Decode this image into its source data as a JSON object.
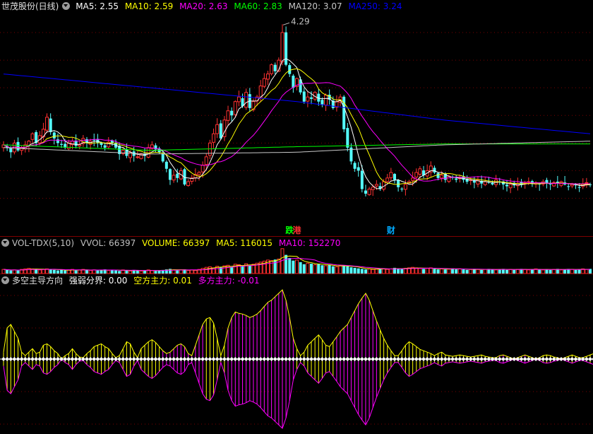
{
  "price_legend": {
    "stock_title": "世茂股份(日线)",
    "items": [
      {
        "label": "MA5: 2.55",
        "color": "#ffffff"
      },
      {
        "label": "MA10: 2.59",
        "color": "#ffff00"
      },
      {
        "label": "MA20: 2.63",
        "color": "#ff00ff"
      },
      {
        "label": "MA60: 2.83",
        "color": "#00ff00"
      },
      {
        "label": "MA120: 3.07",
        "color": "#c8c8c8"
      },
      {
        "label": "MA250: 3.24",
        "color": "#0000ff"
      }
    ]
  },
  "vol_legend": {
    "title": "VOL-TDX(5,10)",
    "items": [
      {
        "label": "VVOL: 66397",
        "color": "#c0c0c0"
      },
      {
        "label": "VOLUME: 66397",
        "color": "#ffff00"
      },
      {
        "label": "MA5: 116015",
        "color": "#ffff00"
      },
      {
        "label": "MA10: 152270",
        "color": "#ff00ff"
      }
    ]
  },
  "osc_legend": {
    "title": "多空主导方向",
    "items": [
      {
        "label": "强弱分界: 0.00",
        "color": "#ffffff"
      },
      {
        "label": "空方主力: 0.01",
        "color": "#ffff00"
      },
      {
        "label": "多方主力: -0.01",
        "color": "#ff00ff"
      }
    ]
  },
  "badges": [
    {
      "text": "跌",
      "color": "#00ff00",
      "candle": 79
    },
    {
      "text": "港",
      "color": "#ff3030",
      "candle": 81
    },
    {
      "text": "财",
      "color": "#00aaff",
      "candle": 107
    }
  ],
  "chart_data": [
    {
      "type": "candlestick",
      "title": "世茂股份(日线)",
      "annotations": [
        {
          "text": "4.29",
          "candle": 77,
          "value": 4.29,
          "note": "high"
        }
      ],
      "close": [
        2.98,
        2.95,
        2.9,
        3.0,
        2.92,
        2.95,
        2.98,
        3.02,
        3.1,
        3.0,
        3.08,
        3.15,
        3.28,
        3.12,
        3.05,
        3.0,
        2.98,
        2.95,
        3.0,
        3.02,
        2.97,
        2.98,
        3.05,
        3.0,
        3.02,
        3.03,
        3.0,
        2.98,
        2.95,
        3.01,
        3.0,
        2.95,
        2.88,
        2.92,
        2.86,
        2.9,
        2.86,
        2.85,
        2.88,
        2.86,
        2.95,
        2.98,
        2.93,
        2.9,
        2.8,
        2.72,
        2.6,
        2.65,
        2.62,
        2.7,
        2.55,
        2.58,
        2.62,
        2.66,
        2.68,
        2.76,
        2.85,
        3.0,
        3.1,
        3.2,
        3.05,
        3.25,
        3.35,
        3.3,
        3.45,
        3.5,
        3.4,
        3.55,
        3.38,
        3.45,
        3.5,
        3.62,
        3.7,
        3.75,
        3.85,
        3.78,
        3.9,
        4.2,
        3.85,
        3.75,
        3.6,
        3.7,
        3.55,
        3.45,
        3.5,
        3.48,
        3.55,
        3.45,
        3.42,
        3.52,
        3.47,
        3.38,
        3.45,
        3.5,
        3.15,
        2.95,
        2.8,
        2.72,
        2.7,
        2.5,
        2.45,
        2.5,
        2.52,
        2.55,
        2.5,
        2.58,
        2.62,
        2.68,
        2.6,
        2.52,
        2.5,
        2.55,
        2.58,
        2.62,
        2.68,
        2.72,
        2.65,
        2.7,
        2.75,
        2.68,
        2.62,
        2.65,
        2.6,
        2.64,
        2.63,
        2.6,
        2.62,
        2.6,
        2.58,
        2.6,
        2.57,
        2.6,
        2.56,
        2.58,
        2.57,
        2.55,
        2.6,
        2.58,
        2.55,
        2.53,
        2.55,
        2.54,
        2.56,
        2.55,
        2.57,
        2.58,
        2.56,
        2.57,
        2.55,
        2.58,
        2.56,
        2.55,
        2.57,
        2.56,
        2.58,
        2.55,
        2.53,
        2.55,
        2.54,
        2.52,
        2.55,
        2.57,
        2.55
      ],
      "ma_series": [
        {
          "name": "MA5",
          "color": "#ffffff",
          "period": 5
        },
        {
          "name": "MA10",
          "color": "#ffff00",
          "period": 10
        },
        {
          "name": "MA20",
          "color": "#ff00ff",
          "period": 20
        },
        {
          "name": "MA60",
          "color": "#00ff00",
          "values": [
            2.98,
            2.92,
            2.96,
            2.99,
            2.99
          ]
        },
        {
          "name": "MA120",
          "color": "#c8c8c8",
          "values": [
            2.95,
            2.88,
            2.9,
            2.98,
            3.02
          ]
        },
        {
          "name": "MA250",
          "color": "#0000ff",
          "values": [
            3.75,
            3.6,
            3.45,
            3.25,
            3.1
          ]
        }
      ],
      "ylim": [
        2.25,
        4.4
      ],
      "gridlines": [
        2.4,
        2.7,
        3.0,
        3.3,
        3.6,
        3.9,
        4.2
      ]
    },
    {
      "type": "bar",
      "title": "VOL-TDX(5,10)",
      "ylim": [
        0,
        60
      ],
      "values": [
        8,
        7,
        6,
        7,
        6,
        8,
        9,
        10,
        9,
        8,
        7,
        8,
        9,
        8,
        7,
        6,
        7,
        6,
        7,
        8,
        6,
        7,
        8,
        7,
        6,
        7,
        6,
        7,
        8,
        6,
        7,
        6,
        5,
        7,
        6,
        5,
        7,
        6,
        5,
        6,
        7,
        6,
        5,
        6,
        7,
        8,
        9,
        7,
        6,
        7,
        8,
        6,
        7,
        6,
        8,
        10,
        12,
        13,
        11,
        14,
        12,
        15,
        16,
        13,
        18,
        17,
        14,
        19,
        15,
        18,
        20,
        22,
        24,
        26,
        25,
        27,
        28,
        48,
        36,
        30,
        25,
        26,
        22,
        18,
        20,
        19,
        17,
        18,
        16,
        15,
        17,
        14,
        13,
        15,
        16,
        14,
        12,
        11,
        10,
        9,
        8,
        9,
        8,
        9,
        10,
        9,
        8,
        9,
        11,
        10,
        9,
        10,
        11,
        12,
        11,
        10,
        9,
        10,
        11,
        9,
        8,
        9,
        8,
        9,
        10,
        8,
        9,
        8,
        7,
        8,
        9,
        8,
        7,
        8,
        9,
        8,
        7,
        8,
        9,
        7,
        8,
        7,
        8,
        9,
        8,
        7,
        8,
        9,
        8,
        7,
        8,
        7,
        8,
        9,
        7,
        8,
        9,
        8,
        7,
        8,
        9,
        8,
        9
      ]
    },
    {
      "type": "oscillator",
      "title": "多空主导方向",
      "ylim": [
        -1,
        1
      ],
      "values": [
        0.1,
        0.45,
        0.5,
        0.4,
        0.3,
        0.1,
        -0.05,
        -0.1,
        -0.15,
        -0.08,
        0.1,
        0.2,
        0.22,
        0.18,
        0.12,
        0.08,
        0.0,
        -0.05,
        -0.08,
        -0.15,
        -0.08,
        -0.03,
        0.02,
        0.08,
        0.12,
        0.18,
        0.2,
        0.22,
        0.18,
        0.15,
        0.08,
        0.02,
        -0.05,
        -0.15,
        -0.25,
        -0.22,
        -0.1,
        0.02,
        0.15,
        0.2,
        0.25,
        0.28,
        0.24,
        0.18,
        0.12,
        0.08,
        0.1,
        0.15,
        0.2,
        0.22,
        0.18,
        0.08,
        -0.05,
        -0.2,
        -0.35,
        -0.5,
        -0.58,
        -0.6,
        -0.52,
        -0.3,
        -0.05,
        0.2,
        0.45,
        0.6,
        0.68,
        0.66,
        0.65,
        0.63,
        0.6,
        0.62,
        0.65,
        0.7,
        0.76,
        0.82,
        0.85,
        0.9,
        0.95,
        1.0,
        0.85,
        0.6,
        0.3,
        0.15,
        0.05,
        -0.1,
        -0.2,
        -0.25,
        -0.3,
        -0.35,
        -0.28,
        -0.2,
        -0.18,
        -0.25,
        -0.32,
        -0.4,
        -0.45,
        -0.5,
        -0.6,
        -0.7,
        -0.8,
        -0.88,
        -0.95,
        -0.85,
        -0.7,
        -0.55,
        -0.42,
        -0.3,
        -0.2,
        -0.12,
        -0.05,
        0.05,
        0.12,
        0.2,
        0.25,
        0.22,
        0.18,
        0.14,
        0.12,
        0.1,
        0.08,
        0.05,
        0.08,
        0.1,
        0.06,
        0.05,
        0.04,
        0.05,
        0.06,
        0.05,
        0.04,
        0.03,
        0.04,
        0.05,
        0.06,
        0.04,
        0.03,
        0.02,
        -0.02,
        -0.05,
        -0.06,
        -0.04,
        -0.02,
        0.0,
        0.02,
        0.04,
        0.06,
        0.04,
        0.02,
        0.0,
        -0.02,
        -0.05,
        -0.06,
        -0.05,
        -0.03,
        -0.02,
        0.0,
        0.02,
        0.04,
        0.06,
        0.04,
        0.02,
        -0.02,
        -0.04,
        -0.06,
        -0.08,
        -0.05,
        -0.03,
        -0.05
      ]
    }
  ]
}
